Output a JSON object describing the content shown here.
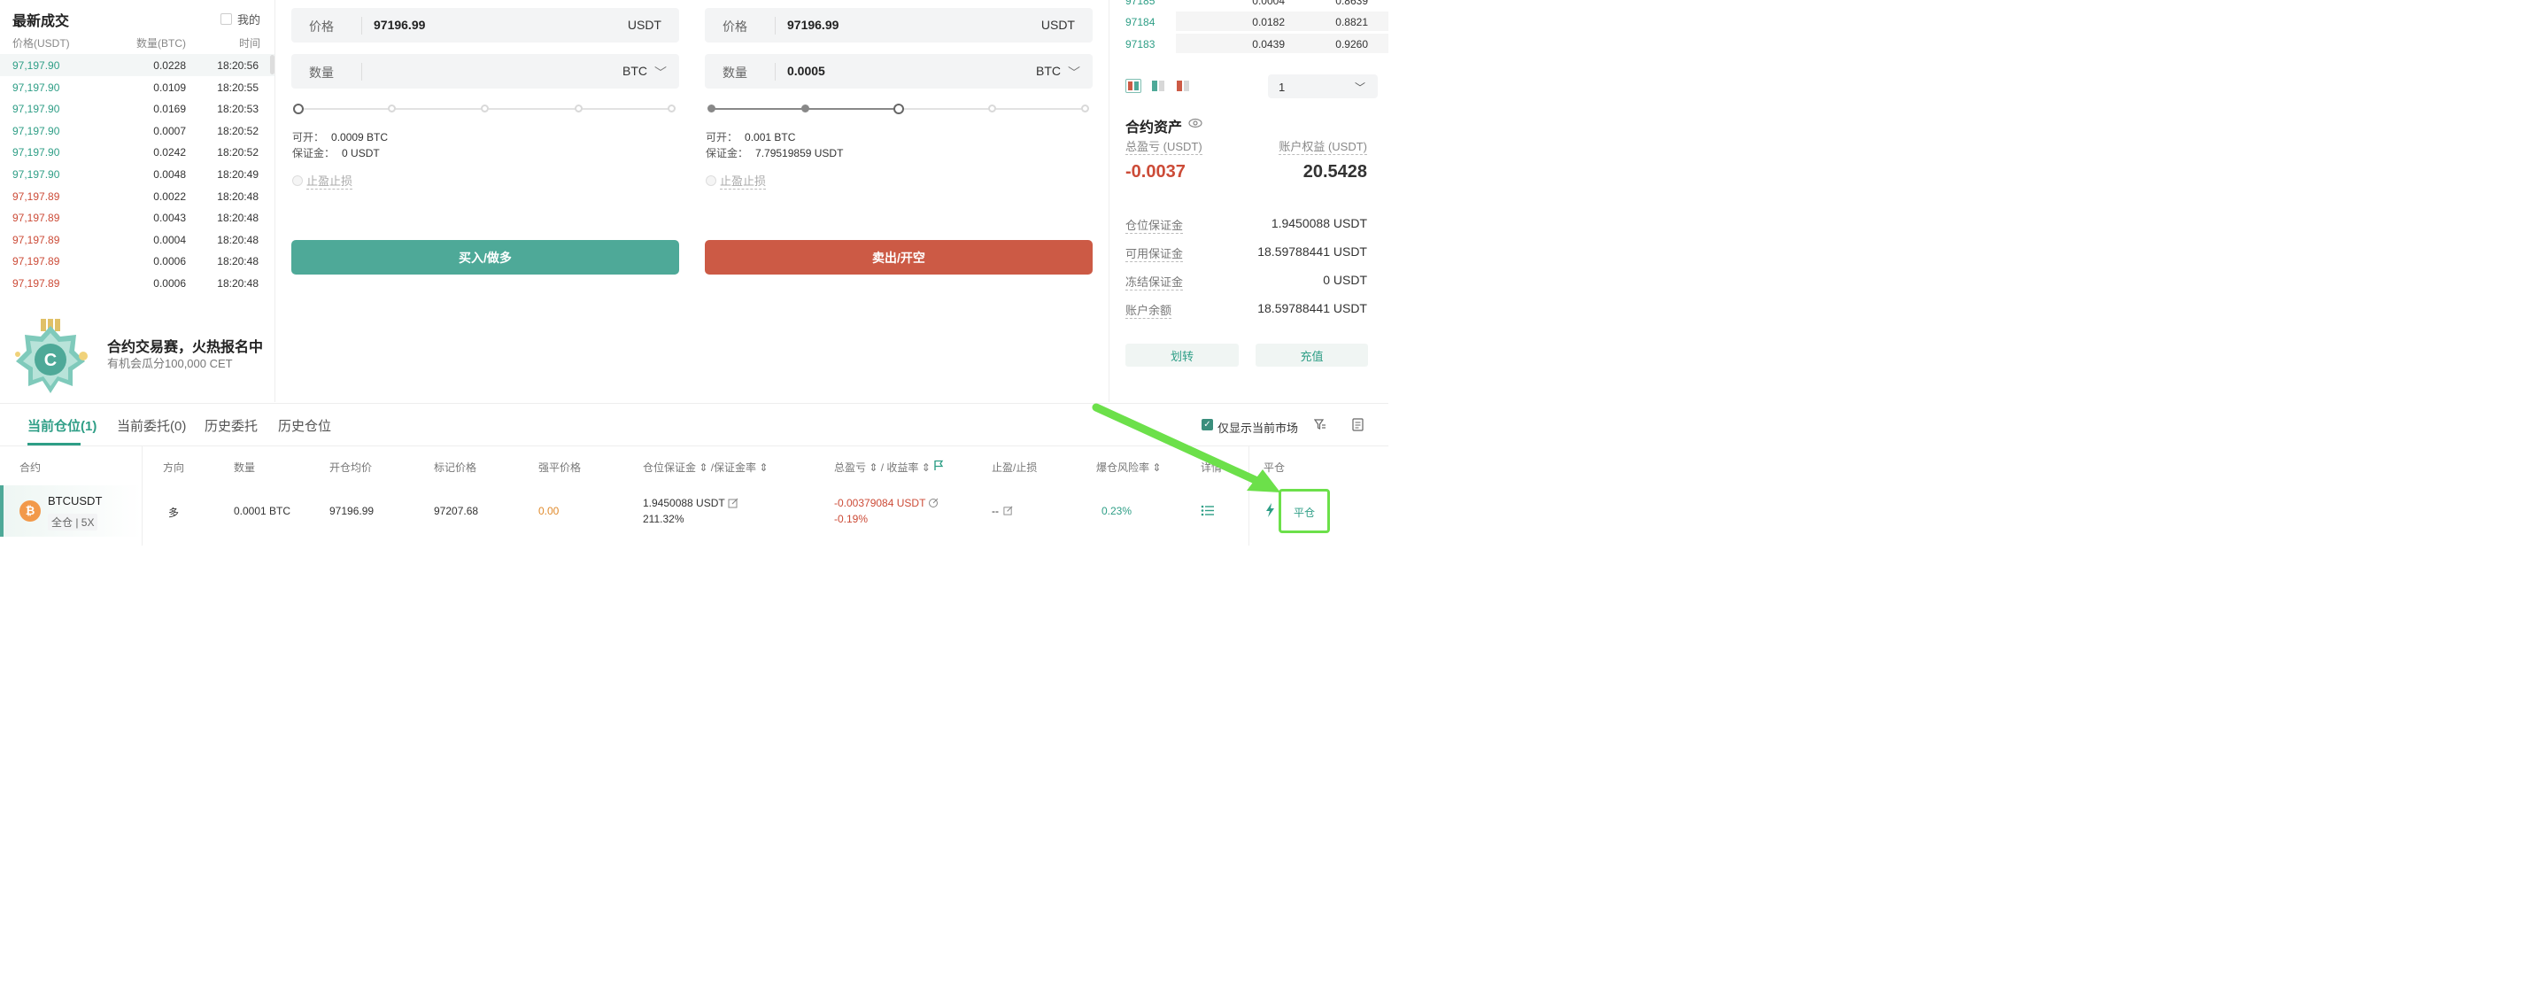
{
  "trades": {
    "title": "最新成交",
    "mine_label": "我的",
    "headers": {
      "price": "价格(USDT)",
      "qty": "数量(BTC)",
      "time": "时间"
    },
    "rows": [
      {
        "price": "97,197.90",
        "qty": "0.0228",
        "time": "18:20:56",
        "side": "up"
      },
      {
        "price": "97,197.90",
        "qty": "0.0109",
        "time": "18:20:55",
        "side": "up"
      },
      {
        "price": "97,197.90",
        "qty": "0.0169",
        "time": "18:20:53",
        "side": "up"
      },
      {
        "price": "97,197.90",
        "qty": "0.0007",
        "time": "18:20:52",
        "side": "up"
      },
      {
        "price": "97,197.90",
        "qty": "0.0242",
        "time": "18:20:52",
        "side": "up"
      },
      {
        "price": "97,197.90",
        "qty": "0.0048",
        "time": "18:20:49",
        "side": "up"
      },
      {
        "price": "97,197.89",
        "qty": "0.0022",
        "time": "18:20:48",
        "side": "down"
      },
      {
        "price": "97,197.89",
        "qty": "0.0043",
        "time": "18:20:48",
        "side": "down"
      },
      {
        "price": "97,197.89",
        "qty": "0.0004",
        "time": "18:20:48",
        "side": "down"
      },
      {
        "price": "97,197.89",
        "qty": "0.0006",
        "time": "18:20:48",
        "side": "down"
      },
      {
        "price": "97,197.89",
        "qty": "0.0006",
        "time": "18:20:48",
        "side": "down"
      }
    ]
  },
  "promo": {
    "title": "合约交易赛，火热报名中",
    "subtitle": "有机会瓜分100,000 CET"
  },
  "buy_form": {
    "price_label": "价格",
    "price_value": "97196.99",
    "price_unit": "USDT",
    "qty_label": "数量",
    "qty_value": "",
    "qty_unit": "BTC",
    "slider_percent": 0,
    "open_label": "可开：",
    "open_value": "0.0009 BTC",
    "margin_label": "保证金：",
    "margin_value": "0 USDT",
    "tpsl_label": "止盈止损",
    "submit_label": "买入/做多"
  },
  "sell_form": {
    "price_label": "价格",
    "price_value": "97196.99",
    "price_unit": "USDT",
    "qty_label": "数量",
    "qty_value": "0.0005",
    "qty_unit": "BTC",
    "slider_percent": 50,
    "open_label": "可开：",
    "open_value": "0.001 BTC",
    "margin_label": "保证金：",
    "margin_value": "7.79519859 USDT",
    "tpsl_label": "止盈止损",
    "submit_label": "卖出/开空"
  },
  "orderbook": {
    "rows": [
      {
        "price": "97185",
        "amount": "0.0004",
        "cum": "0.8639"
      },
      {
        "price": "97184",
        "amount": "0.0182",
        "cum": "0.8821"
      },
      {
        "price": "97183",
        "amount": "0.0439",
        "cum": "0.9260"
      }
    ],
    "depth_value": "1"
  },
  "assets": {
    "title": "合约资产",
    "pnl_label": "总盈亏 (USDT)",
    "equity_label": "账户权益 (USDT)",
    "pnl_value": "-0.0037",
    "equity_value": "20.5428",
    "items": [
      {
        "label": "仓位保证金",
        "value": "1.9450088 USDT"
      },
      {
        "label": "可用保证金",
        "value": "18.59788441 USDT"
      },
      {
        "label": "冻结保证金",
        "value": "0 USDT"
      },
      {
        "label": "账户余额",
        "value": "18.59788441 USDT"
      }
    ],
    "transfer_label": "划转",
    "deposit_label": "充值"
  },
  "positions": {
    "tabs": [
      "当前仓位(1)",
      "当前委托(0)",
      "历史委托",
      "历史仓位"
    ],
    "only_current_label": "仅显示当前市场",
    "headers": {
      "contract": "合约",
      "direction": "方向",
      "qty": "数量",
      "avg": "开仓均价",
      "mark": "标记价格",
      "liq": "强平价格",
      "margin": "仓位保证金 ⇕ /保证金率 ⇕",
      "pnl": "总盈亏 ⇕  / 收益率 ⇕",
      "tpsl": "止盈/止损",
      "risk": "爆仓风险率 ⇕",
      "detail": "详情",
      "close": "平仓"
    },
    "row": {
      "symbol": "BTCUSDT",
      "leverage": "全仓 | 5X",
      "direction": "多",
      "qty": "0.0001 BTC",
      "avg": "97196.99",
      "mark": "97207.68",
      "liq": "0.00",
      "margin": "1.9450088 USDT",
      "margin_rate": "211.32%",
      "pnl": "-0.00379084 USDT",
      "pnl_rate": "-0.19%",
      "tpsl": "--",
      "risk": "0.23%",
      "close_label": "平仓"
    }
  },
  "colors": {
    "up": "#2e9e86",
    "down": "#cc4b37",
    "accent": "#4ea998",
    "annotation": "#6ce04a"
  }
}
